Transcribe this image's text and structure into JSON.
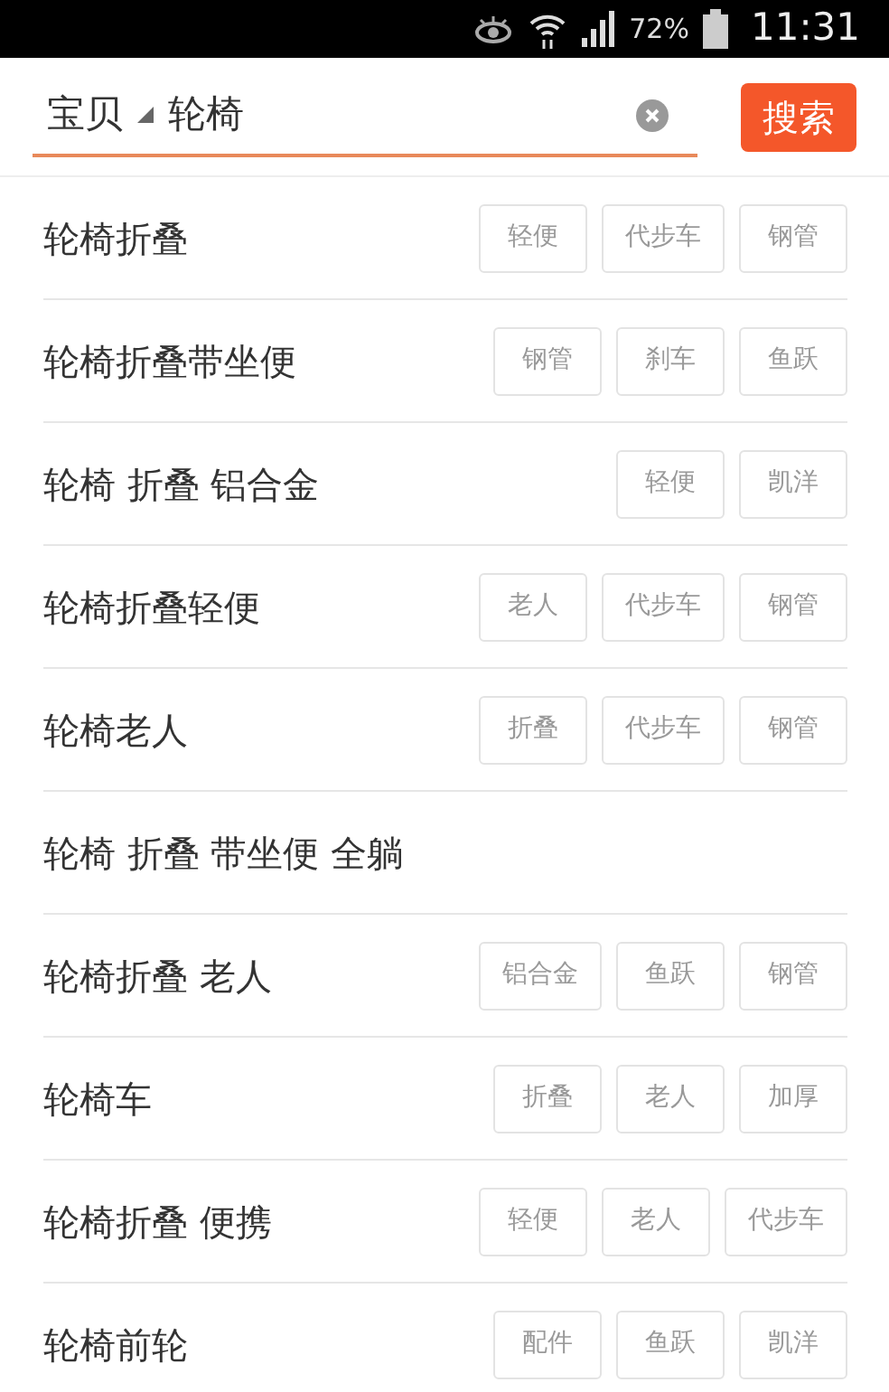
{
  "status_bar": {
    "battery": "72%",
    "time": "11:31"
  },
  "search": {
    "scope": "宝贝",
    "value": "轮椅",
    "button": "搜索"
  },
  "suggestions": [
    {
      "text": "轮椅折叠",
      "tags": [
        "轻便",
        "代步车",
        "钢管"
      ]
    },
    {
      "text": "轮椅折叠带坐便",
      "tags": [
        "钢管",
        "刹车",
        "鱼跃"
      ]
    },
    {
      "text": "轮椅 折叠 铝合金",
      "tags": [
        "轻便",
        "凯洋"
      ]
    },
    {
      "text": "轮椅折叠轻便",
      "tags": [
        "老人",
        "代步车",
        "钢管"
      ]
    },
    {
      "text": "轮椅老人",
      "tags": [
        "折叠",
        "代步车",
        "钢管"
      ]
    },
    {
      "text": "轮椅 折叠 带坐便 全躺"
    },
    {
      "text": "轮椅折叠 老人",
      "tags": [
        "铝合金",
        "鱼跃",
        "钢管"
      ]
    },
    {
      "text": "轮椅车",
      "tags": [
        "折叠",
        "老人",
        "加厚"
      ]
    },
    {
      "text": "轮椅折叠 便携",
      "tags": [
        "轻便",
        "老人",
        "代步车"
      ]
    },
    {
      "text": "轮椅前轮",
      "tags": [
        "配件",
        "鱼跃",
        "凯洋"
      ]
    }
  ]
}
